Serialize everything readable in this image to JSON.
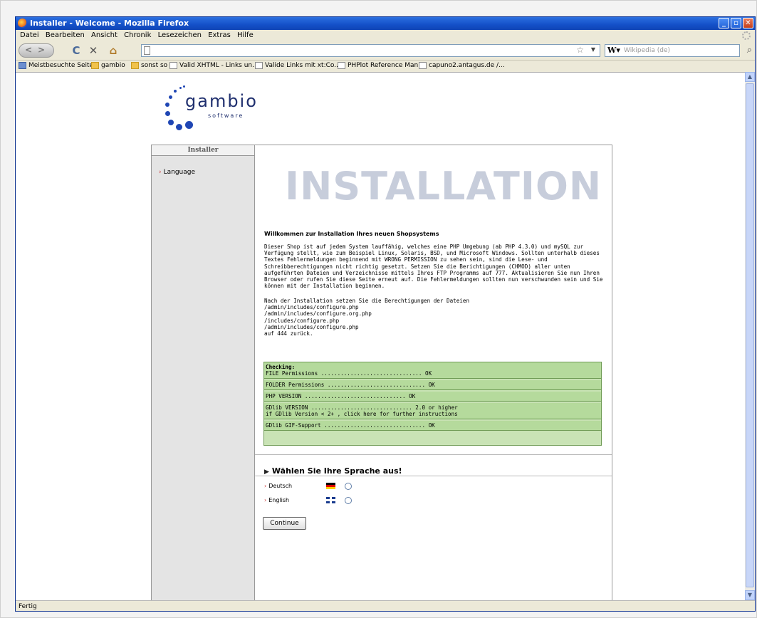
{
  "window": {
    "title": "Installer - Welcome - Mozilla Firefox"
  },
  "menu": [
    "Datei",
    "Bearbeiten",
    "Ansicht",
    "Chronik",
    "Lesezeichen",
    "Extras",
    "Hilfe"
  ],
  "search": {
    "placeholder": "Wikipedia (de)"
  },
  "bookmarks": [
    "Meistbesuchte Seiten",
    "gambio",
    "sonst so",
    "Valid XHTML - Links un...",
    "Valide Links mit xt:Co...",
    "PHPlot Reference Man...",
    "capuno2.antagus.de /..."
  ],
  "logo": {
    "word": "gambio",
    "sub": "software"
  },
  "sidebar": {
    "heading": "Installer",
    "item": "Language"
  },
  "main": {
    "title": "INSTALLATION",
    "welcome": "Willkommen zur Installation Ihres neuen Shopsystems",
    "para1": "Dieser Shop ist auf jedem System lauffähig, welches eine PHP Umgebung (ab PHP 4.3.0) und mySQL zur Verfügung stellt, wie zum Beispiel Linux, Solaris, BSD, und Microsoft Windows. Sollten unterhalb dieses Textes Fehlermeldungen beginnend mit WRONG PERMISSION zu sehen sein, sind die Lese- und Schreibberechtigungen nicht richtig gesetzt. Setzen Sie die Berichtigungen (CHMOD) aller unten aufgeführten Dateien und Verzeichnisse mittels Ihres FTP Programms auf 777. Aktualisieren Sie nun Ihren Browser oder rufen Sie diese Seite erneut auf. Die Fehlermeldungen sollten nun verschwunden sein und Sie können mit der Installation beginnen.",
    "para2_intro": "Nach der Installation setzen Sie die Berechtigungen der Dateien",
    "files": [
      "/admin/includes/configure.php",
      "/admin/includes/configure.org.php",
      "/includes/configure.php",
      "/admin/includes/configure.php"
    ],
    "para2_outro": "auf 444 zurück.",
    "checks": {
      "heading": "Checking:",
      "file": "FILE Permissions ............................... OK",
      "folder": "FOLDER Permissions .............................. OK",
      "php": "PHP VERSION ............................... OK",
      "gdlib": "GDlib VERSION ............................... 2.0 or higher",
      "gdlib_note": "if GDlib Version < 2+ , click here for further instructions",
      "gif": "GDlib GIF-Support ............................... OK"
    },
    "lang_heading": "Wählen Sie Ihre Sprache aus!",
    "lang_de": "Deutsch",
    "lang_en": "English",
    "continue": "Continue"
  },
  "status": "Fertig"
}
